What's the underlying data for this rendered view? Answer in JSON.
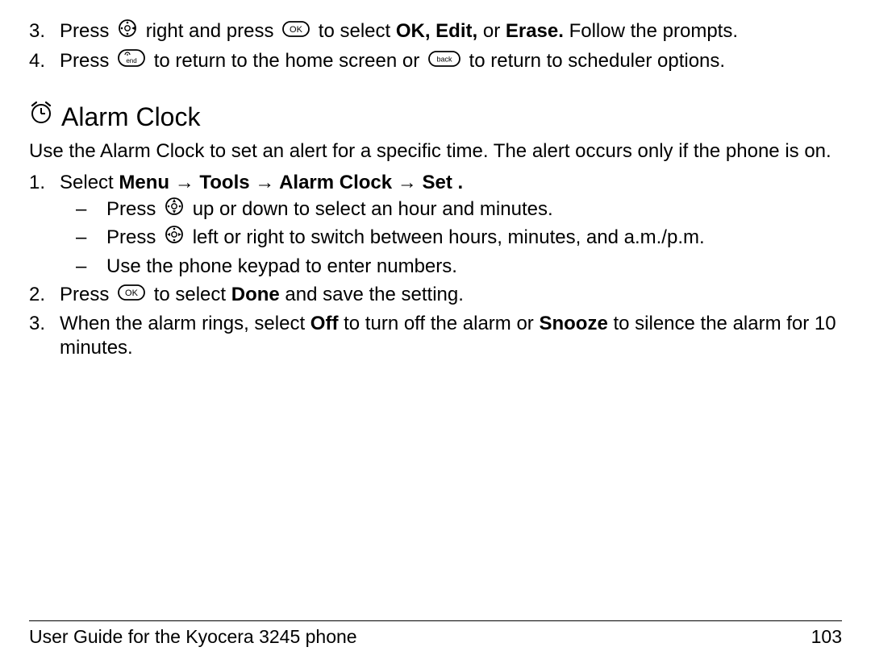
{
  "top_steps": {
    "s3": {
      "num": "3.",
      "t1": "Press ",
      "t2": " right and press ",
      "t3": " to select ",
      "bold": "OK, Edit,",
      "t4": " or ",
      "bold2": "Erase.",
      "t5": " Follow the prompts."
    },
    "s4": {
      "num": "4.",
      "t1": "Press ",
      "t2": " to return to the home screen or ",
      "t3": " to return to scheduler options."
    }
  },
  "heading": "Alarm Clock",
  "intro": "Use the Alarm Clock to set an alert for a specific time. The alert occurs only if the phone is on.",
  "alarm_steps": {
    "s1": {
      "num": "1.",
      "t1": "Select ",
      "path_menu": "Menu",
      "path_tools": "Tools",
      "path_alarm": "Alarm Clock",
      "path_set": "Set",
      "arrow": " → ",
      "period": ".",
      "sub_a": {
        "dash": "–",
        "t1": "Press ",
        "t2": " up or down to select an hour and minutes."
      },
      "sub_b": {
        "dash": "–",
        "t1": "Press ",
        "t2": " left or right to switch between hours, minutes, and a.m./p.m."
      },
      "sub_c": {
        "dash": "–",
        "t1": "Use the phone keypad to enter numbers."
      }
    },
    "s2": {
      "num": "2.",
      "t1": "Press ",
      "t2": " to select ",
      "bold_done": "Done",
      "t3": " and save the setting."
    },
    "s3": {
      "num": "3.",
      "t1": "When the alarm rings, select ",
      "bold_off": "Off",
      "t2": " to turn off the alarm or ",
      "bold_snooze": "Snooze",
      "t3": " to silence the alarm for 10 minutes."
    }
  },
  "footer": {
    "left": "User Guide for the Kyocera 3245 phone",
    "right": "103"
  }
}
